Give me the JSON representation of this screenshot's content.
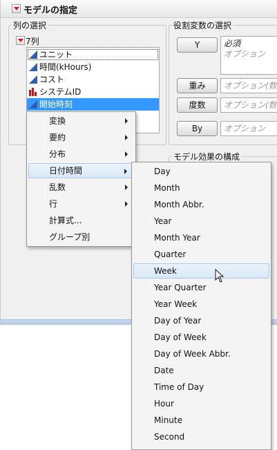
{
  "window": {
    "title": "モデルの指定"
  },
  "columns": {
    "section_label": "列の選択",
    "count_label": "7列",
    "items": [
      {
        "label": "ユニット",
        "type": "continuous"
      },
      {
        "label": "時間(kHours)",
        "type": "continuous"
      },
      {
        "label": "コスト",
        "type": "continuous"
      },
      {
        "label": "システムID",
        "type": "nominal"
      },
      {
        "label": "開始時刻",
        "type": "continuous"
      }
    ]
  },
  "roles": {
    "section_label": "役割変数の選択",
    "y": {
      "button": "Y",
      "required": "必須",
      "optional": "オプション"
    },
    "weight": {
      "button": "重み",
      "placeholder": "オプション(数"
    },
    "freq": {
      "button": "度数",
      "placeholder": "オプション(数"
    },
    "by": {
      "button": "By",
      "placeholder": "オプション"
    }
  },
  "effects": {
    "section_label": "モデル効果の構成"
  },
  "context_menu": {
    "items": [
      {
        "label": "変換",
        "submenu": true
      },
      {
        "label": "要約",
        "submenu": true
      },
      {
        "label": "分布",
        "submenu": true
      },
      {
        "label": "日付時間",
        "submenu": true,
        "active": true
      },
      {
        "label": "乱数",
        "submenu": true
      },
      {
        "label": "行",
        "submenu": true
      },
      {
        "label": "計算式...",
        "submenu": false
      },
      {
        "label": "グループ別",
        "submenu": false
      }
    ]
  },
  "datetime_submenu": {
    "items": [
      "Day",
      "Month",
      "Month Abbr.",
      "Year",
      "Month Year",
      "Quarter",
      "Week",
      "Year Quarter",
      "Year Week",
      "Day of Year",
      "Day of Week",
      "Day of Week Abbr.",
      "Date",
      "Time of Day",
      "Hour",
      "Minute",
      "Second"
    ],
    "hovered": "Week"
  },
  "colors": {
    "selection": "#3399ff",
    "continuous_icon": "#2f5fb3",
    "nominal_icon": "#c4161c",
    "menu_hover": "#d9e8f7"
  }
}
